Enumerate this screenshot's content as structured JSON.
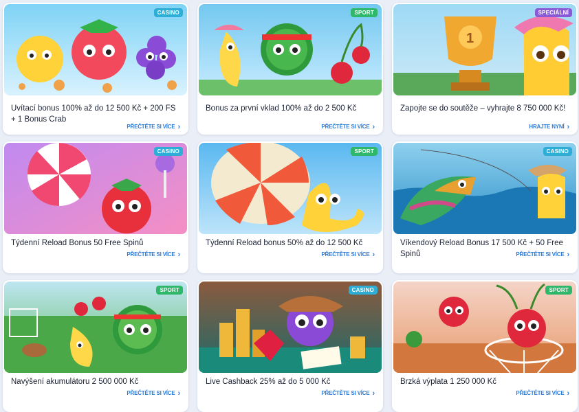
{
  "colors": {
    "casino_badge": "#2eaed6",
    "sport_badge": "#2fb86a",
    "special_badge": "#8a5ad6",
    "link": "#2d7bd6"
  },
  "promos": [
    {
      "badge": "Casino",
      "title": "Uvítací bonus 100% až do 12 500 Kč + 200 FS + 1 Bonus Crab",
      "link": "Přečtěte si více"
    },
    {
      "badge": "Sport",
      "title": "Bonus za první vklad 100% až do 2 500 Kč",
      "link": "Přečtěte si více"
    },
    {
      "badge": "Speciální",
      "title": "Zapojte se do soutěže – vyhrajte 8 750 000 Kč!",
      "link": "Hrajte nyní"
    },
    {
      "badge": "Casino",
      "title": "Týdenní Reload Bonus 50 Free Spinů",
      "link": "Přečtěte si více"
    },
    {
      "badge": "Sport",
      "title": "Týdenní Reload bonus 50% až do 12 500 Kč",
      "link": "Přečtěte si více"
    },
    {
      "badge": "Casino",
      "title": "Víkendový Reload Bonus 17 500 Kč + 50 Free Spinů",
      "link": "Přečtěte si více"
    },
    {
      "badge": "Sport",
      "title": "Navýšení akumulátoru 2 500 000 Kč",
      "link": "Přečtěte si více"
    },
    {
      "badge": "Casino",
      "title": "Live Cashback 25% až do 5 000 Kč",
      "link": "Přečtěte si více"
    },
    {
      "badge": "Sport",
      "title": "Brzká výplata 1 250 000 Kč",
      "link": "Přečtěte si více"
    }
  ]
}
